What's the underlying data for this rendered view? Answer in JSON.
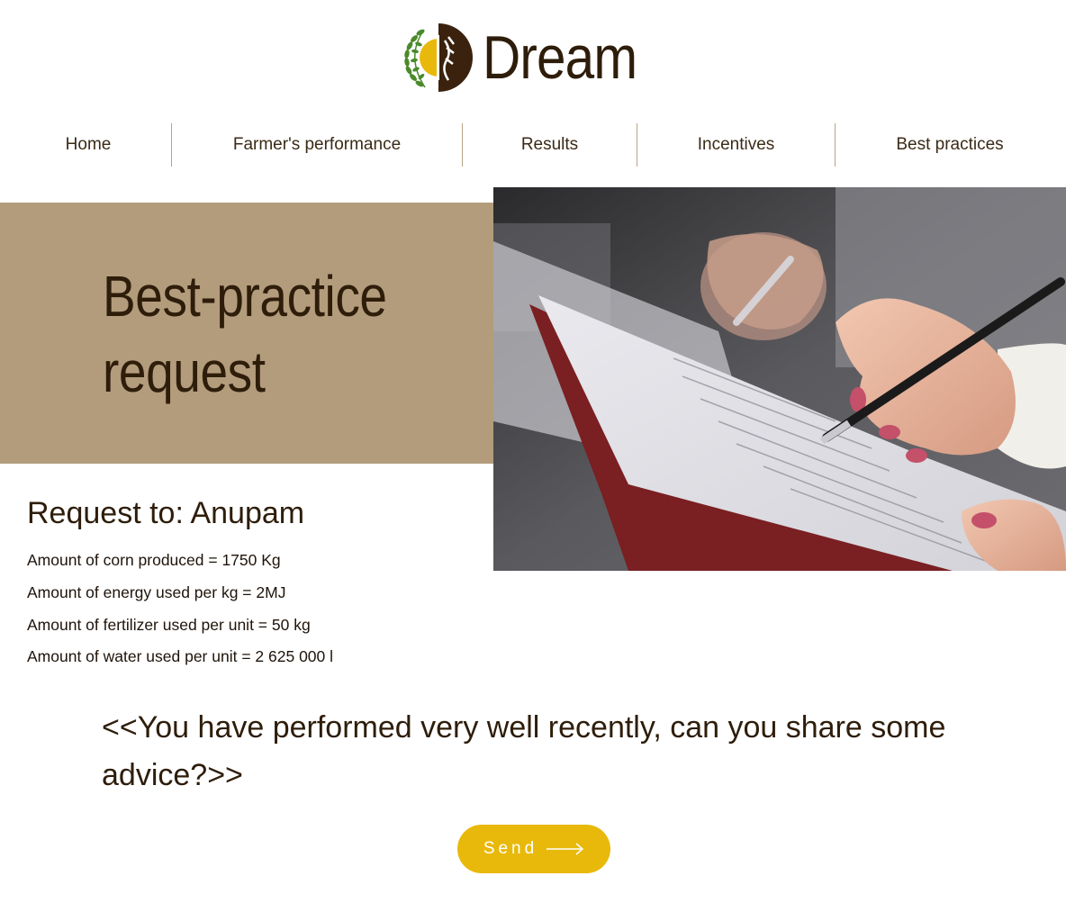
{
  "brand": {
    "name": "Dream",
    "logo_icon": "wheat-leaf-logo-icon",
    "colors": {
      "dark_brown": "#2e1d0a",
      "tan": "#b39c7c",
      "yellow": "#e8b90b",
      "green": "#4a8a2a"
    }
  },
  "nav": {
    "items": [
      {
        "label": "Home"
      },
      {
        "label": "Farmer's performance"
      },
      {
        "label": "Results"
      },
      {
        "label": "Incentives"
      },
      {
        "label": "Best practices"
      }
    ]
  },
  "hero": {
    "title": "Best-practice request",
    "image_icon": "hand-writing-document-photo"
  },
  "request": {
    "heading": "Request to: Anupam",
    "metrics": [
      "Amount of corn produced = 1750 Kg",
      "Amount of energy used per kg = 2MJ",
      "Amount of fertilizer used per unit = 50 kg",
      "Amount of water used per unit = 2 625 000 l"
    ],
    "message": "<<You have performed very well recently, can you share some advice?>>"
  },
  "actions": {
    "send_label": "Send",
    "send_icon": "arrow-right-icon"
  }
}
